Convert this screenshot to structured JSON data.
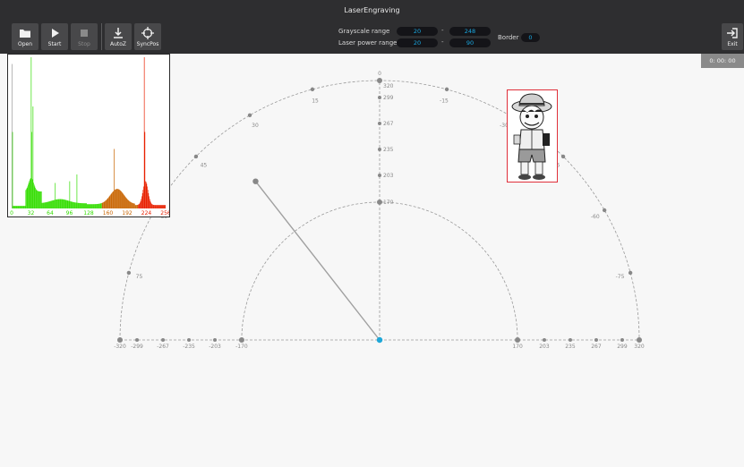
{
  "window": {
    "title": "LaserEngraving"
  },
  "toolbar": {
    "buttons": [
      {
        "label": "Open"
      },
      {
        "label": "Start"
      },
      {
        "label": "Stop"
      },
      {
        "label": "AutoZ"
      },
      {
        "label": "SyncPos"
      }
    ],
    "exit_label": "Exit"
  },
  "settings": {
    "grayscale_label": "Grayscale  range",
    "grayscale_min": "20",
    "grayscale_max": "248",
    "power_label": "Laser power range",
    "power_min": "20",
    "power_max": "90",
    "border_label": "Border",
    "border_value": "0",
    "separator": "-"
  },
  "timer": "0: 00: 00",
  "histogram": {
    "tick_labels": [
      "0",
      "32",
      "64",
      "96",
      "128",
      "160",
      "192",
      "224",
      "256"
    ],
    "colors": {
      "green": "#33dd00",
      "orange": "#c86400",
      "red": "#e82000",
      "gray": "#9a9a9a"
    }
  },
  "workspace": {
    "outer_radius": 320,
    "inner_radius": 170,
    "vertical_scale": [
      "320",
      "299",
      "267",
      "235",
      "203",
      "170"
    ],
    "left_scale": [
      "-320",
      "-299",
      "-267",
      "-235",
      "-203",
      "-170"
    ],
    "right_scale": [
      "170",
      "203",
      "235",
      "267",
      "299",
      "320"
    ],
    "angle_labels": [
      "0",
      "15",
      "30",
      "45",
      "60",
      "75",
      "-15",
      "-30",
      "-45",
      "-60",
      "-75"
    ],
    "arm_angle_deg": 38,
    "colors": {
      "origin": "#1ea7d8",
      "tick": "#888888",
      "line": "#9a9a9a",
      "arm": "#a0a0a0"
    }
  },
  "image": {
    "name": "luffy-image",
    "frame_color": "#e0303a"
  }
}
